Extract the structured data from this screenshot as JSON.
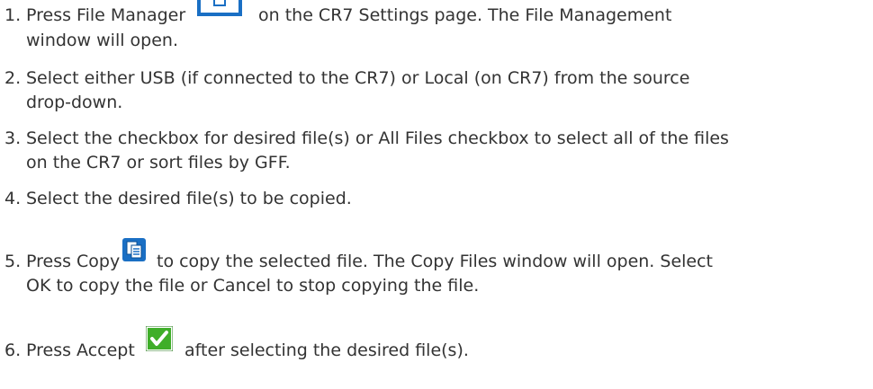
{
  "steps": [
    {
      "number": "1.",
      "lines": [
        "Press File Manager",
        "on the CR7 Settings page. The File Management",
        "window will open."
      ],
      "icon": "file-manager-icon"
    },
    {
      "number": "2.",
      "lines": [
        "Select either USB (if connected to the CR7) or Local (on CR7) from the source",
        "drop-down."
      ]
    },
    {
      "number": "3.",
      "lines": [
        "Select the checkbox for desired file(s) or All Files checkbox to select all of the files",
        "on the CR7 or sort files by GFF."
      ]
    },
    {
      "number": "4.",
      "lines": [
        "Select the desired file(s) to be copied."
      ]
    },
    {
      "number": "5.",
      "lines": [
        "Press Copy",
        "to copy the selected file. The Copy Files window will open. Select",
        "OK to copy the file or Cancel to stop copying the file."
      ],
      "icon": "copy-icon"
    },
    {
      "number": "6.",
      "lines": [
        "Press Accept",
        "after selecting the desired file(s)."
      ],
      "icon": "accept-checkmark-icon"
    }
  ],
  "colors": {
    "text": "#333333",
    "icon_blue": "#1a6fc4",
    "accept_green": "#3fae29"
  }
}
